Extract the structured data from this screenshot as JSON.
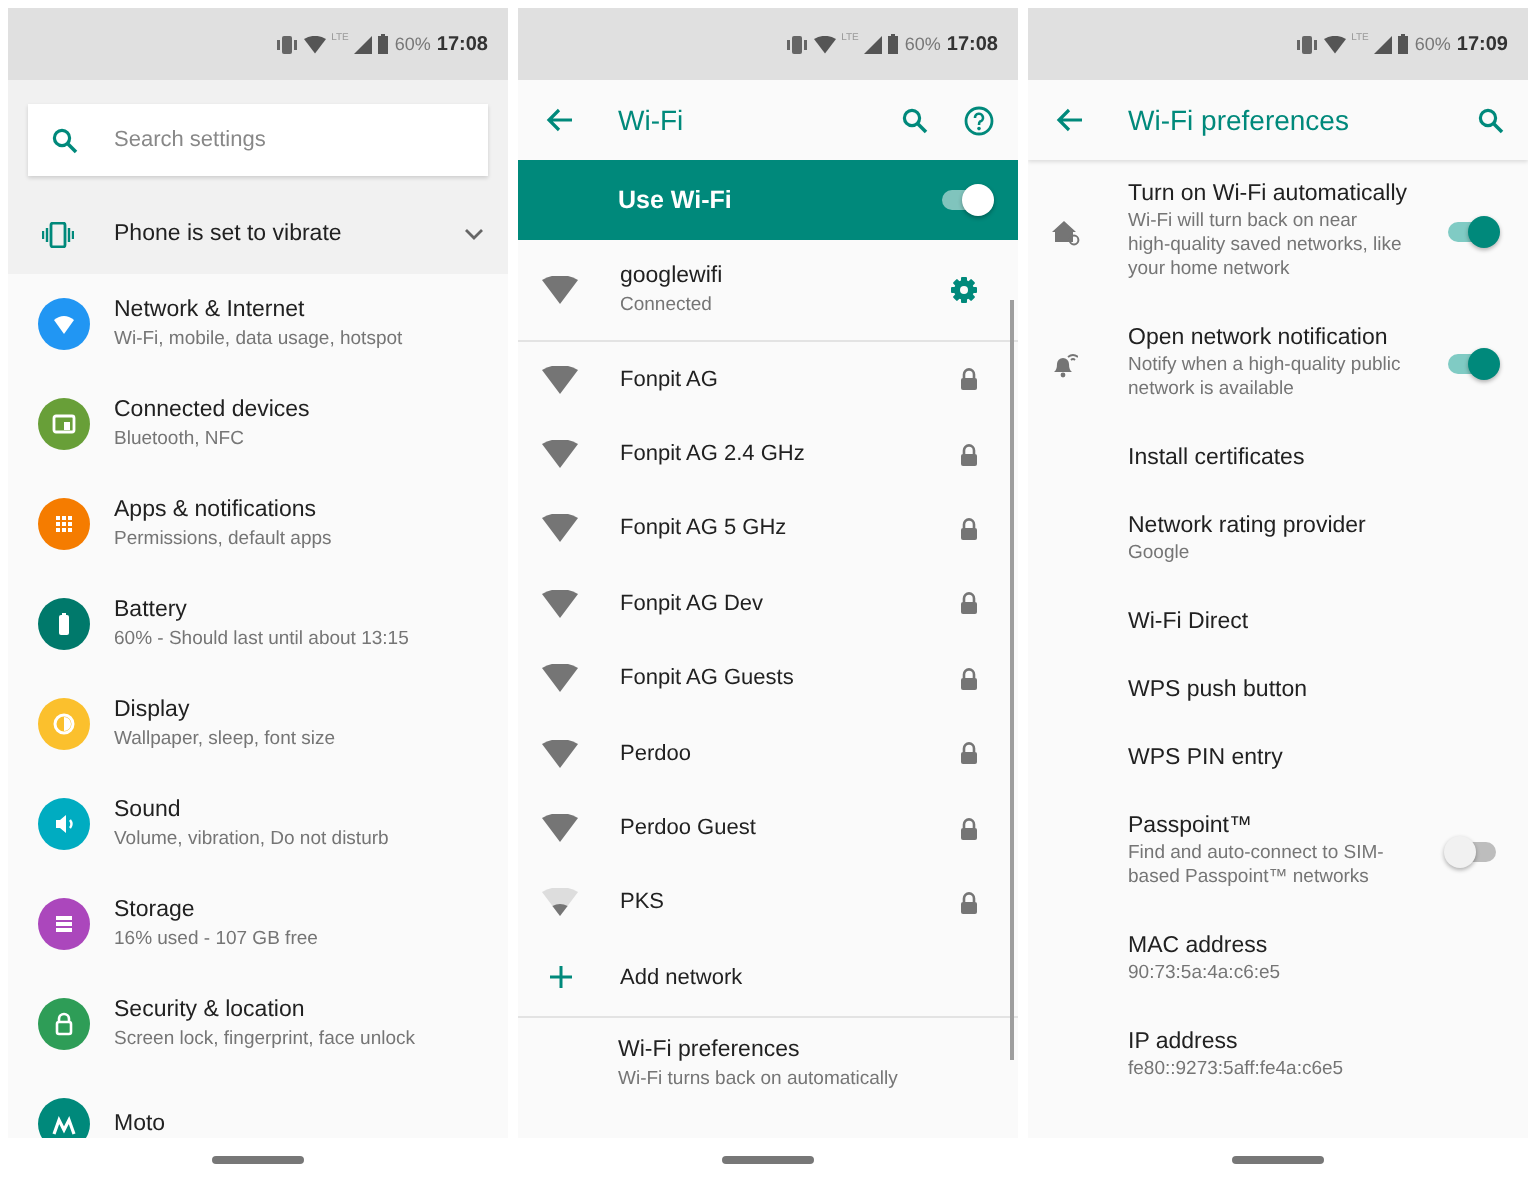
{
  "settings": {
    "status_bar": {
      "network": "LTE",
      "battery": "60%",
      "time": "17:08"
    },
    "search": {
      "placeholder": "Search settings"
    },
    "banner": {
      "text": "Phone is set to vibrate",
      "expanded": false
    },
    "items": [
      {
        "kind": "network",
        "title": "Network & Internet",
        "subtitle": "Wi-Fi, mobile, data usage, hotspot",
        "color": "#2196f3"
      },
      {
        "kind": "devices",
        "title": "Connected devices",
        "subtitle": "Bluetooth, NFC",
        "color": "#689f38"
      },
      {
        "kind": "apps",
        "title": "Apps & notifications",
        "subtitle": "Permissions, default apps",
        "color": "#f57c00"
      },
      {
        "kind": "battery",
        "title": "Battery",
        "subtitle": "60% - Should last until about 13:15",
        "color": "#00796b"
      },
      {
        "kind": "display",
        "title": "Display",
        "subtitle": "Wallpaper, sleep, font size",
        "color": "#fbc02d"
      },
      {
        "kind": "sound",
        "title": "Sound",
        "subtitle": "Volume, vibration, Do not disturb",
        "color": "#00acc1"
      },
      {
        "kind": "storage",
        "title": "Storage",
        "subtitle": "16% used - 107 GB free",
        "color": "#ab47bc"
      },
      {
        "kind": "security",
        "title": "Security & location",
        "subtitle": "Screen lock, fingerprint, face unlock",
        "color": "#2e9d57"
      },
      {
        "kind": "moto",
        "title": "Moto",
        "color": "#00897b"
      }
    ]
  },
  "wifi": {
    "status_bar": {
      "network": "LTE",
      "battery": "60%",
      "time": "17:08"
    },
    "title": "Wi-Fi",
    "master": {
      "label": "Use Wi-Fi",
      "on": true
    },
    "connected": {
      "name": "googlewifi",
      "status": "Connected"
    },
    "networks": [
      {
        "name": "Fonpit AG",
        "secured": true,
        "weak_signal": false
      },
      {
        "name": "Fonpit AG 2.4 GHz",
        "secured": true,
        "weak_signal": false
      },
      {
        "name": "Fonpit AG 5 GHz",
        "secured": true,
        "weak_signal": false
      },
      {
        "name": "Fonpit AG Dev",
        "secured": true,
        "weak_signal": false
      },
      {
        "name": "Fonpit AG Guests",
        "secured": true,
        "weak_signal": false
      },
      {
        "name": "Perdoo",
        "secured": true,
        "weak_signal": false
      },
      {
        "name": "Perdoo Guest",
        "secured": true,
        "weak_signal": false
      },
      {
        "name": "PKS",
        "secured": true,
        "weak_signal": true
      }
    ],
    "add": {
      "label": "Add network"
    },
    "preferences_link": {
      "title": "Wi-Fi preferences",
      "subtitle": "Wi-Fi turns back on automatically"
    }
  },
  "preferences": {
    "status_bar": {
      "network": "LTE",
      "battery": "60%",
      "time": "17:09"
    },
    "title": "Wi-Fi preferences",
    "items": [
      {
        "kind": "switch",
        "title": "Turn on Wi-Fi automatically",
        "subtitle": "Wi-Fi will turn back on near high-quality saved networks, like your home network",
        "on": true
      },
      {
        "kind": "switch",
        "title": "Open network notification",
        "subtitle": "Notify when a high-quality public network is available",
        "on": true
      },
      {
        "kind": "plain",
        "title": "Install certificates"
      },
      {
        "kind": "plain",
        "title": "Network rating provider",
        "subtitle": "Google"
      },
      {
        "kind": "plain",
        "title": "Wi-Fi Direct"
      },
      {
        "kind": "plain",
        "title": "WPS push button"
      },
      {
        "kind": "plain",
        "title": "WPS PIN entry"
      },
      {
        "kind": "switch",
        "title": "Passpoint™",
        "subtitle": "Find and auto-connect to SIM-based Passpoint™ networks",
        "on": false
      },
      {
        "kind": "plain",
        "title": "MAC address",
        "subtitle": "90:73:5a:4a:c6:e5"
      },
      {
        "kind": "plain",
        "title": "IP address",
        "subtitle": "fe80::9273:5aff:fe4a:c6e5"
      }
    ]
  }
}
